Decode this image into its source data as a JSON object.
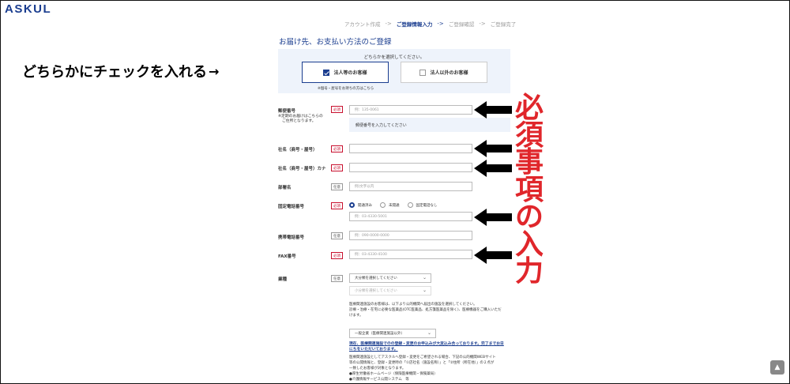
{
  "brand": {
    "logo": "ASKUL"
  },
  "steps": [
    {
      "label": "アカウント作成",
      "active": false
    },
    {
      "label": "ご登録情報入力",
      "active": true
    },
    {
      "label": "ご登録確認",
      "active": false
    },
    {
      "label": "ご登録完了",
      "active": false
    }
  ],
  "form_title": "お届け先、お支払い方法のご登録",
  "customer_type": {
    "prompt": "どちらかを選択してください。",
    "option_corp": "法人等のお客様",
    "option_individual": "法人以外のお客様",
    "note": "※個号・屋号をお持ちの方はこちら"
  },
  "badges": {
    "required": "必須",
    "optional": "任意"
  },
  "fields": {
    "postal": {
      "label": "郵便番号",
      "sub1": "※定期のお届けはこちらの",
      "sub2": "ご住所となります。",
      "placeholder": "例：135-0061",
      "hint": "郵便番号を入力してください"
    },
    "company": {
      "label": "社名（商号・屋号）",
      "placeholder": ""
    },
    "company_kana": {
      "label": "社名（商号・屋号）カナ",
      "placeholder": ""
    },
    "department": {
      "label": "部署名",
      "placeholder": "例)文字以内"
    },
    "phone": {
      "label": "固定電話番号",
      "radio1": "開通済み",
      "radio2": "未開通",
      "radio3": "固定電話なし",
      "placeholder": "例：03-4330-5001"
    },
    "mobile": {
      "label": "携帯電話番号",
      "placeholder": "例：090-0000-0000"
    },
    "fax": {
      "label": "FAX番号",
      "placeholder": "例：03-4330-4100"
    },
    "industry": {
      "label": "業種",
      "select1": "大分類を選択してください",
      "select2": "小分類を選択してください"
    }
  },
  "medical": {
    "para1_l1": "医療関連施設のお客様は、以下より公的機関へ届出の施設を選択してください。",
    "para1_l2": "診療・治療・在宅に必要な医薬品(OTC医薬品、処方箋医薬品を除く)、医療機器をご購入いただ",
    "para1_l3": "けます。",
    "select": "一般企業（医療関連施設以外）",
    "warn1": "現在、医療関連施設でのの登録・変更のお申込みが大変込み合っております。完了までお日",
    "warn2": "にちをいただいております。",
    "para2_l1": "医療関連施設としてアスクルへ登録・変更をご希望される場合、下記の公的機関WEBサイト",
    "para2_l2": "等の公開情報と、登録・変更時の「①店社名（施設名称）」と「②住所（所在地）」の２点が",
    "para2_l3": "一致したお客様が対象となります。",
    "para2_l4": "●厚生労働省ホームページ（保険医療機関・保険薬局）",
    "para2_l5": "●介護情報サービス公開システム　等"
  },
  "annotations": {
    "left": "どちらかにチェックを入れる",
    "left_arrow": "→",
    "right": [
      "必",
      "須",
      "事",
      "項",
      "の",
      "入",
      "力"
    ]
  },
  "colors": {
    "brand": "#1a3d8f",
    "required": "#c8102e",
    "annotation": "#e0262b",
    "panel": "#eef3fb"
  }
}
